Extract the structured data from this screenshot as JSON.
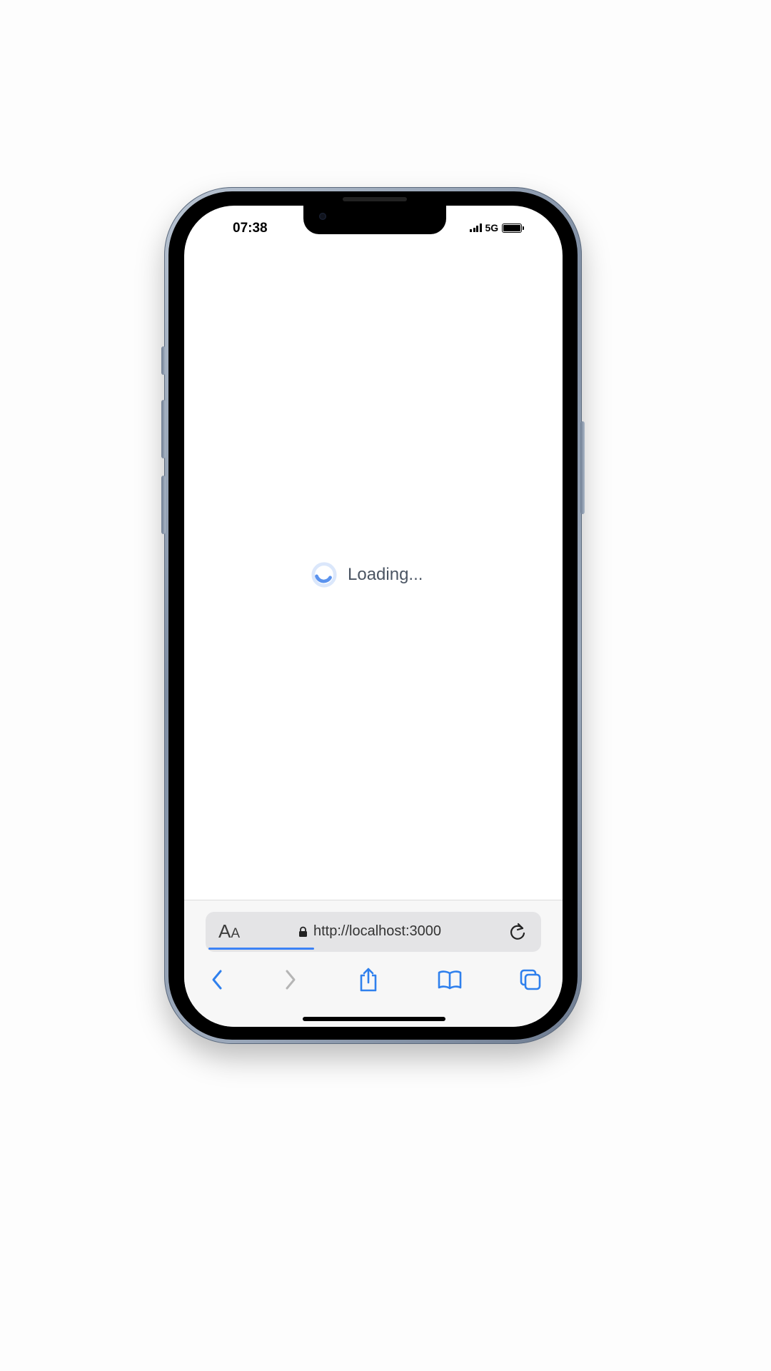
{
  "status_bar": {
    "time": "07:38",
    "network": "5G",
    "signal_icon": "signal-bars-icon",
    "battery_icon": "battery-full-icon"
  },
  "content": {
    "loading_text": "Loading...",
    "spinner_icon": "loading-spinner-icon"
  },
  "browser": {
    "text_size_label_large": "A",
    "text_size_label_small": "A",
    "url": "http://localhost:3000",
    "lock_icon": "lock-icon",
    "reload_icon": "reload-icon",
    "load_progress": 0.32,
    "toolbar": [
      {
        "name": "back-button",
        "icon": "chevron-left-icon",
        "enabled": true
      },
      {
        "name": "forward-button",
        "icon": "chevron-right-icon",
        "enabled": false
      },
      {
        "name": "share-button",
        "icon": "share-icon",
        "enabled": true
      },
      {
        "name": "bookmarks-button",
        "icon": "book-icon",
        "enabled": true
      },
      {
        "name": "tabs-button",
        "icon": "tabs-icon",
        "enabled": true
      }
    ]
  },
  "colors": {
    "accent": "#3b82f6",
    "toolbar_icon": "#2f80ed",
    "disabled_icon": "#b5b5b5",
    "loading_text": "#4b5563"
  }
}
